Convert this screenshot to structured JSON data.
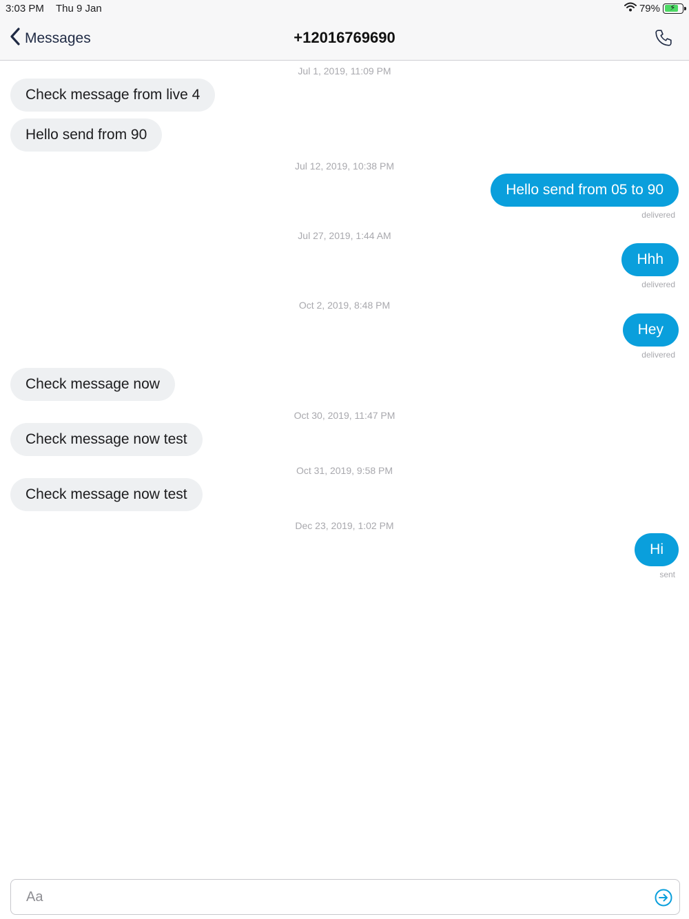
{
  "status_bar": {
    "time": "3:03 PM",
    "date": "Thu 9 Jan",
    "battery_percent": "79%",
    "battery_level": 0.79,
    "battery_color": "#4cd964"
  },
  "nav": {
    "back_label": "Messages",
    "title": "+12016769690",
    "back_icon": "chevron-left-icon",
    "call_icon": "phone-icon"
  },
  "messages": [
    {
      "timestamp": "Jul 1, 2019, 11:09 PM"
    },
    {
      "direction": "incoming",
      "text": "Check message from live 4"
    },
    {
      "direction": "incoming",
      "text": "Hello send from 90"
    },
    {
      "timestamp": "Jul 12, 2019, 10:38 PM"
    },
    {
      "direction": "outgoing",
      "text": "Hello send from 05 to 90",
      "status": "delivered"
    },
    {
      "timestamp": "Jul 27, 2019, 1:44 AM"
    },
    {
      "direction": "outgoing",
      "text": "Hhh",
      "status": "delivered"
    },
    {
      "timestamp": "Oct 2, 2019, 8:48 PM"
    },
    {
      "direction": "outgoing",
      "text": "Hey",
      "status": "delivered"
    },
    {
      "direction": "incoming",
      "text": "Check message now"
    },
    {
      "timestamp": "Oct 30, 2019, 11:47 PM"
    },
    {
      "direction": "incoming",
      "text": "Check message now test"
    },
    {
      "timestamp": "Oct 31, 2019, 9:58 PM"
    },
    {
      "direction": "incoming",
      "text": "Check message now test"
    },
    {
      "timestamp": "Dec 23, 2019, 1:02 PM"
    },
    {
      "direction": "outgoing",
      "text": "Hi",
      "status": "sent"
    }
  ],
  "composer": {
    "placeholder": "Aa",
    "value": "",
    "send_icon": "send-arrow-icon"
  },
  "colors": {
    "outgoing_bubble": "#0a9fdc",
    "incoming_bubble": "#eef0f2",
    "accent": "#0a9fdc"
  }
}
